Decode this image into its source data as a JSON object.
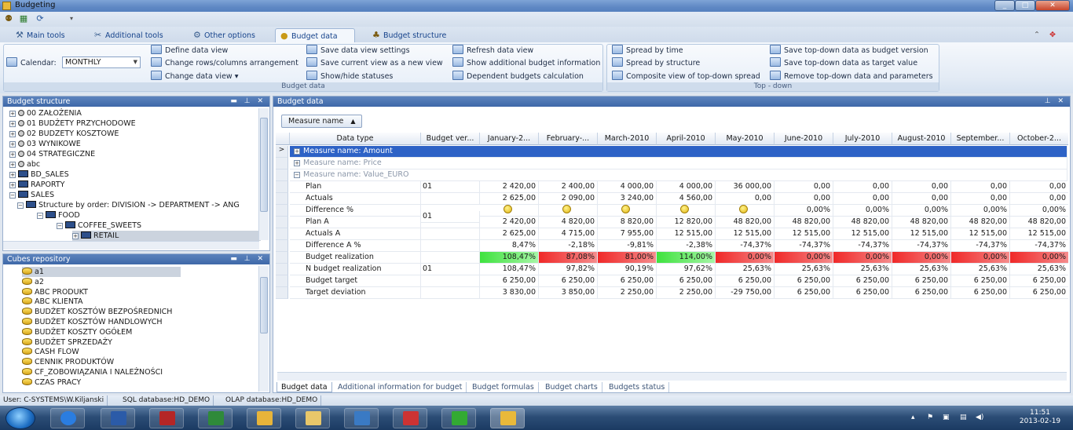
{
  "window": {
    "title": "Budgeting",
    "min": "_",
    "max": "□",
    "close": "✕"
  },
  "ribbon_tabs": [
    {
      "label": "Main tools",
      "icon": "tools-icon"
    },
    {
      "label": "Additional tools",
      "icon": "wrench-icon"
    },
    {
      "label": "Other options",
      "icon": "gear-icon"
    },
    {
      "label": "Budget data",
      "icon": "coins-icon"
    },
    {
      "label": "Budget structure",
      "icon": "hierarchy-icon"
    }
  ],
  "ribbon": {
    "calendar_label": "Calendar:",
    "calendar_value": "MONTHLY",
    "group1": {
      "label": "Budget data",
      "items": [
        "Define data view",
        "Change rows/columns arrangement",
        "Change data view",
        "Save data view settings",
        "Save current view as a new view",
        "Show/hide statuses",
        "Refresh data view",
        "Show additional budget information",
        "Dependent budgets calculation"
      ]
    },
    "group2": {
      "label": "Top - down",
      "items": [
        "Spread by time",
        "Spread by structure",
        "Composite view of top-down spread",
        "Save top-down data as budget version",
        "Save top-down data as target value",
        "Remove top-down data and parameters"
      ]
    }
  },
  "budget_structure": {
    "title": "Budget structure",
    "items": [
      {
        "label": "00 ZAŁOŻENIA",
        "type": "dim"
      },
      {
        "label": "01 BUDŻETY PRZYCHODOWE",
        "type": "dim"
      },
      {
        "label": "02 BUDZETY KOSZTOWE",
        "type": "dim"
      },
      {
        "label": "03 WYNIKOWE",
        "type": "dim"
      },
      {
        "label": "04 STRATEGICZNE",
        "type": "dim"
      },
      {
        "label": "abc",
        "type": "dim"
      },
      {
        "label": "BD_SALES",
        "type": "folder"
      },
      {
        "label": "RAPORTY",
        "type": "folder"
      },
      {
        "label": "SALES",
        "type": "folder"
      },
      {
        "label": "Structure by order: DIVISION -> DEPARTMENT -> ANG",
        "type": "struct"
      },
      {
        "label": "FOOD",
        "type": "node"
      },
      {
        "label": "COFFEE_SWEETS",
        "type": "node"
      },
      {
        "label": "RETAIL",
        "type": "node"
      }
    ]
  },
  "cubes_repository": {
    "title": "Cubes repository",
    "items": [
      "a1",
      "a2",
      "ABC PRODUKT",
      "ABC KLIENTA",
      "BUDŻET KOSZTÓW BEZPOŚREDNICH",
      "BUDŻET KOSZTÓW HANDLOWYCH",
      "BUDŻET KOSZTY OGÓŁEM",
      "BUDŻET SPRZEDAŻY",
      "CASH FLOW",
      "CENNIK PRODUKTÓW",
      "CF_ZOBOWIĄZANIA I NALEŻNOŚCI",
      "CZAS PRACY"
    ]
  },
  "budget_data": {
    "title": "Budget data",
    "measure_button": "Measure name",
    "columns": [
      "Data type",
      "Budget ver...",
      "January-2...",
      "February-...",
      "March-2010",
      "April-2010",
      "May-2010",
      "June-2010",
      "July-2010",
      "August-2010",
      "September...",
      "October-2..."
    ],
    "groups": [
      "Measure name: Amount",
      "Measure name: Price",
      "Measure name: Value_EURO"
    ],
    "rows": [
      {
        "name": "Plan",
        "ver": "01",
        "vals": [
          "2 420,00",
          "2 400,00",
          "4 000,00",
          "4 000,00",
          "36 000,00",
          "0,00",
          "0,00",
          "0,00",
          "0,00",
          "0,00"
        ]
      },
      {
        "name": "Actuals",
        "ver": "",
        "vals": [
          "2 625,00",
          "2 090,00",
          "3 240,00",
          "4 560,00",
          "0,00",
          "0,00",
          "0,00",
          "0,00",
          "0,00",
          "0,00"
        ]
      },
      {
        "name": "Difference %",
        "ver": "01",
        "vals": [
          "smile",
          "smile",
          "sad",
          "smile",
          "sad",
          "0,00%",
          "0,00%",
          "0,00%",
          "0,00%",
          "0,00%"
        ]
      },
      {
        "name": "Plan A",
        "ver": "",
        "vals": [
          "2 420,00",
          "4 820,00",
          "8 820,00",
          "12 820,00",
          "48 820,00",
          "48 820,00",
          "48 820,00",
          "48 820,00",
          "48 820,00",
          "48 820,00"
        ]
      },
      {
        "name": "Actuals A",
        "ver": "",
        "vals": [
          "2 625,00",
          "4 715,00",
          "7 955,00",
          "12 515,00",
          "12 515,00",
          "12 515,00",
          "12 515,00",
          "12 515,00",
          "12 515,00",
          "12 515,00"
        ]
      },
      {
        "name": "Difference A %",
        "ver": "",
        "vals": [
          "8,47%",
          "-2,18%",
          "-9,81%",
          "-2,38%",
          "-74,37%",
          "-74,37%",
          "-74,37%",
          "-74,37%",
          "-74,37%",
          "-74,37%"
        ]
      },
      {
        "name": "Budget realization",
        "ver": "",
        "vals": [
          "108,47%",
          "87,08%",
          "81,00%",
          "114,00%",
          "0,00%",
          "0,00%",
          "0,00%",
          "0,00%",
          "0,00%",
          "0,00%"
        ],
        "colors": [
          "green",
          "red",
          "red",
          "green",
          "red",
          "red",
          "red",
          "red",
          "red",
          "red"
        ]
      },
      {
        "name": "N budget realization",
        "ver": "01",
        "vals": [
          "108,47%",
          "97,82%",
          "90,19%",
          "97,62%",
          "25,63%",
          "25,63%",
          "25,63%",
          "25,63%",
          "25,63%",
          "25,63%"
        ]
      },
      {
        "name": "Budget target",
        "ver": "",
        "vals": [
          "6 250,00",
          "6 250,00",
          "6 250,00",
          "6 250,00",
          "6 250,00",
          "6 250,00",
          "6 250,00",
          "6 250,00",
          "6 250,00",
          "6 250,00"
        ]
      },
      {
        "name": "Target deviation",
        "ver": "",
        "vals": [
          "3 830,00",
          "3 850,00",
          "2 250,00",
          "2 250,00",
          "-29 750,00",
          "6 250,00",
          "6 250,00",
          "6 250,00",
          "6 250,00",
          "6 250,00"
        ]
      }
    ]
  },
  "bottom_tabs": [
    "Budget data",
    "Additional information for budget",
    "Budget formulas",
    "Budget charts",
    "Budgets status"
  ],
  "status": {
    "user": "User: C-SYSTEMS\\W.Kiljanski",
    "sql": "SQL database:HD_DEMO",
    "olap": "OLAP database:HD_DEMO"
  },
  "clock": {
    "time": "11:51",
    "date": "2013-02-19"
  },
  "colors": {
    "header": "#3e68a8",
    "selected_row": "#2d62c6",
    "green": "#3ee23e",
    "red": "#f02828"
  }
}
